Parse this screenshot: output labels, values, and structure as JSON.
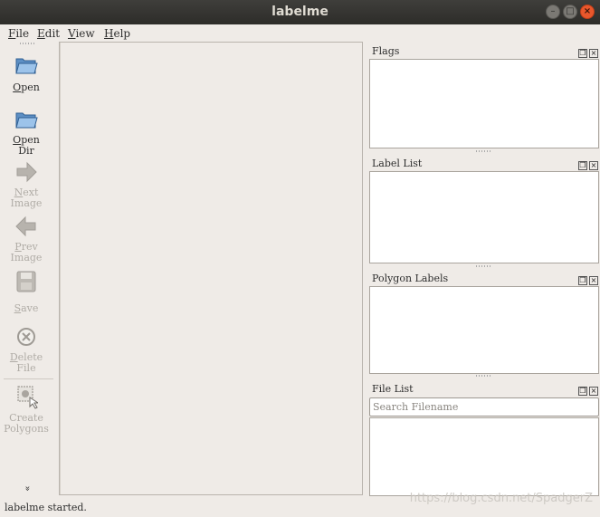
{
  "window": {
    "title": "labelme"
  },
  "menu": [
    {
      "label": "File",
      "u": "F",
      "rest": "ile"
    },
    {
      "label": "Edit",
      "u": "E",
      "rest": "dit"
    },
    {
      "label": "View",
      "u": "V",
      "rest": "iew"
    },
    {
      "label": "Help",
      "u": "H",
      "rest": "elp"
    }
  ],
  "toolbar": {
    "open": {
      "u": "O",
      "rest": "pen",
      "icon": "folder-open-icon"
    },
    "open_dir": {
      "line1_u": "O",
      "line1_rest": "pen",
      "line2": "Dir",
      "icon": "folder-open-icon"
    },
    "next_image": {
      "line1_u": "N",
      "line1_rest": "ext",
      "line2": "Image",
      "icon": "arrow-right-icon",
      "enabled": false
    },
    "prev_image": {
      "line1_u": "P",
      "line1_rest": "rev",
      "line2": "Image",
      "icon": "arrow-left-icon",
      "enabled": false
    },
    "save": {
      "u": "S",
      "rest": "ave",
      "icon": "floppy-disk-icon",
      "enabled": false
    },
    "delete_file": {
      "line1_u": "D",
      "line1_rest": "elete",
      "line2": "File",
      "icon": "delete-circle-icon",
      "enabled": false
    },
    "create_polygons": {
      "line1": "Create",
      "line2": "Polygons",
      "icon": "create-polygon-icon",
      "enabled": false
    },
    "overflow_glyph": "»"
  },
  "docks": {
    "flags": {
      "title": "Flags"
    },
    "label_list": {
      "title": "Label List"
    },
    "polygon_labels": {
      "title": "Polygon Labels"
    },
    "file_list": {
      "title": "File List",
      "search_placeholder": "Search Filename"
    }
  },
  "status": {
    "message": "labelme started."
  },
  "watermark": "https://blog.csdn.net/SpadgerZ",
  "colors": {
    "titlebar": "#2d2c29",
    "close_button": "#e9572c",
    "window_bg": "#efebe7",
    "panel_bg": "#ffffff"
  }
}
